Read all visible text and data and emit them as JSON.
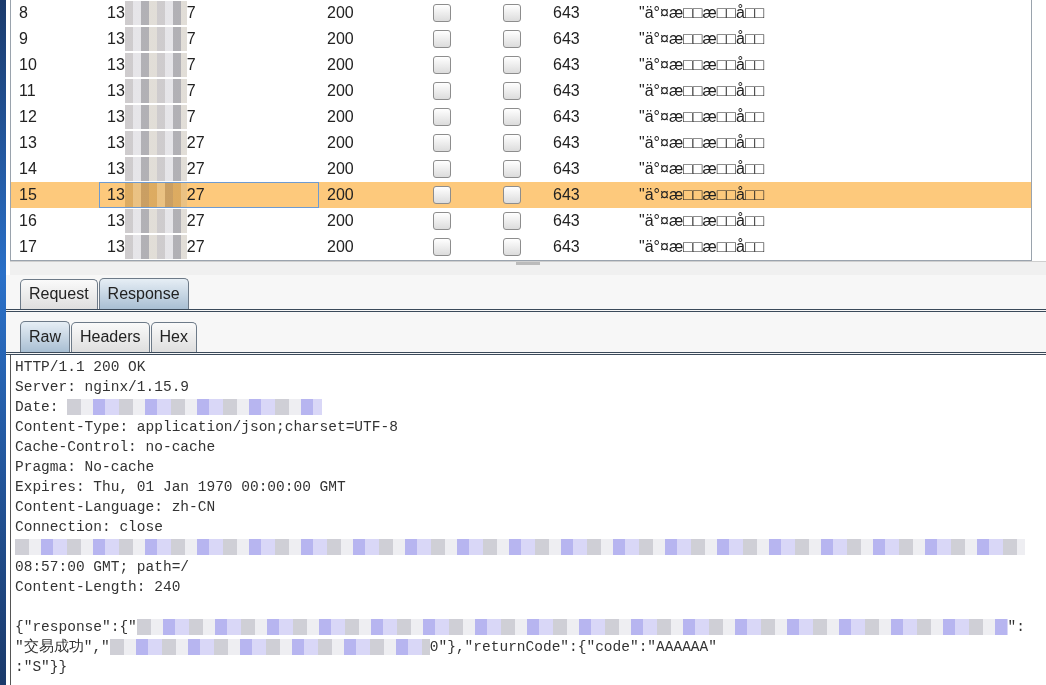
{
  "results": {
    "rows": [
      {
        "index": "8",
        "payload_start": "13",
        "payload_end": "7",
        "status": "200",
        "error": false,
        "timeout": false,
        "length": "643",
        "column_7": "\"ä°¤æ□□æ□□å□□",
        "selected": false
      },
      {
        "index": "9",
        "payload_start": "13",
        "payload_end": "7",
        "status": "200",
        "error": false,
        "timeout": false,
        "length": "643",
        "column_7": "\"ä°¤æ□□æ□□å□□",
        "selected": false
      },
      {
        "index": "10",
        "payload_start": "13",
        "payload_end": "7",
        "status": "200",
        "error": false,
        "timeout": false,
        "length": "643",
        "column_7": "\"ä°¤æ□□æ□□å□□",
        "selected": false
      },
      {
        "index": "11",
        "payload_start": "13",
        "payload_end": "7",
        "status": "200",
        "error": false,
        "timeout": false,
        "length": "643",
        "column_7": "\"ä°¤æ□□æ□□å□□",
        "selected": false
      },
      {
        "index": "12",
        "payload_start": "13",
        "payload_end": "7",
        "status": "200",
        "error": false,
        "timeout": false,
        "length": "643",
        "column_7": "\"ä°¤æ□□æ□□å□□",
        "selected": false
      },
      {
        "index": "13",
        "payload_start": "13",
        "payload_end": "27",
        "status": "200",
        "error": false,
        "timeout": false,
        "length": "643",
        "column_7": "\"ä°¤æ□□æ□□å□□",
        "selected": false
      },
      {
        "index": "14",
        "payload_start": "13",
        "payload_end": "27",
        "status": "200",
        "error": false,
        "timeout": false,
        "length": "643",
        "column_7": "\"ä°¤æ□□æ□□å□□",
        "selected": false
      },
      {
        "index": "15",
        "payload_start": "13",
        "payload_end": "27",
        "status": "200",
        "error": false,
        "timeout": false,
        "length": "643",
        "column_7": "\"ä°¤æ□□æ□□å□□",
        "selected": true
      },
      {
        "index": "16",
        "payload_start": "13",
        "payload_end": "27",
        "status": "200",
        "error": false,
        "timeout": false,
        "length": "643",
        "column_7": "\"ä°¤æ□□æ□□å□□",
        "selected": false
      },
      {
        "index": "17",
        "payload_start": "13",
        "payload_end": "27",
        "status": "200",
        "error": false,
        "timeout": false,
        "length": "643",
        "column_7": "\"ä°¤æ□□æ□□å□□",
        "selected": false
      }
    ]
  },
  "message_tabs": [
    {
      "label": "Request",
      "selected": false
    },
    {
      "label": "Response",
      "selected": true
    }
  ],
  "view_tabs": [
    {
      "label": "Raw",
      "selected": true
    },
    {
      "label": "Headers",
      "selected": false
    },
    {
      "label": "Hex",
      "selected": false
    }
  ],
  "response_lines": [
    {
      "parts": [
        {
          "kind": "text",
          "text": "HTTP/1.1 200 OK"
        }
      ]
    },
    {
      "parts": [
        {
          "kind": "text",
          "text": "Server: nginx/1.15.9"
        }
      ]
    },
    {
      "parts": [
        {
          "kind": "text",
          "text": "Date: "
        },
        {
          "kind": "redacted_short"
        }
      ]
    },
    {
      "parts": [
        {
          "kind": "text",
          "text": "Content-Type: application/json;charset=UTF-8"
        }
      ]
    },
    {
      "parts": [
        {
          "kind": "text",
          "text": "Cache-Control: no-cache"
        }
      ]
    },
    {
      "parts": [
        {
          "kind": "text",
          "text": "Pragma: No-cache"
        }
      ]
    },
    {
      "parts": [
        {
          "kind": "text",
          "text": "Expires: Thu, 01 Jan 1970 00:00:00 GMT"
        }
      ]
    },
    {
      "parts": [
        {
          "kind": "text",
          "text": "Content-Language: zh-CN"
        }
      ]
    },
    {
      "parts": [
        {
          "kind": "text",
          "text": "Connection: close"
        }
      ]
    },
    {
      "parts": [
        {
          "kind": "redacted_line"
        }
      ]
    },
    {
      "parts": [
        {
          "kind": "text",
          "text": "08:57:00 GMT; path=/"
        }
      ]
    },
    {
      "parts": [
        {
          "kind": "text",
          "text": "Content-Length: 240"
        }
      ]
    },
    {
      "blank_line_before": true,
      "parts": [
        {
          "kind": "text",
          "text": "{\"response\":{\""
        },
        {
          "kind": "redacted_line"
        },
        {
          "kind": "text",
          "text": "\":"
        }
      ]
    },
    {
      "parts": [
        {
          "kind": "text",
          "text": "\"交易成功\",\""
        },
        {
          "kind": "redacted_medium"
        },
        {
          "kind": "text",
          "text": "0\"},\"returnCode\":{\"code\":\"AAAAAA\""
        }
      ]
    },
    {
      "parts": [
        {
          "kind": "text",
          "text": ":\"S\"}}"
        }
      ]
    }
  ]
}
